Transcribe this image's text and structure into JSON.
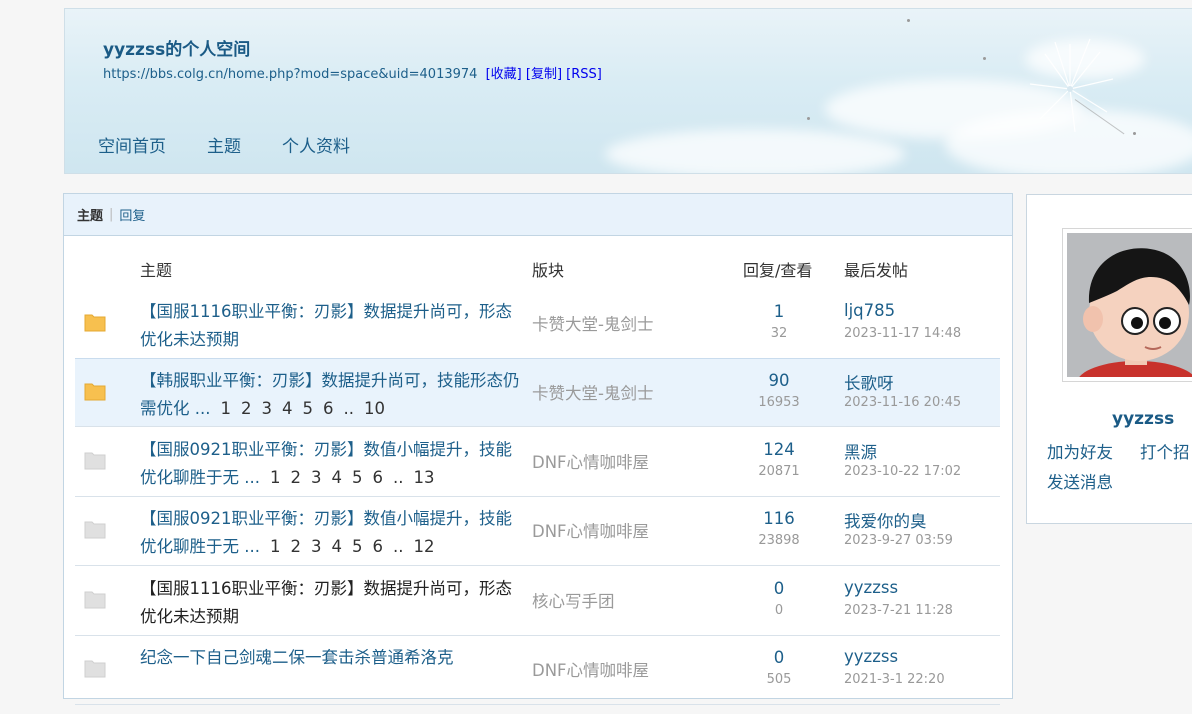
{
  "header": {
    "space_title": "yyzzss的个人空间",
    "space_url": "https://bbs.colg.cn/home.php?mod=space&uid=4013974",
    "url_actions": [
      "[收藏]",
      "[复制]",
      "[RSS]"
    ],
    "nav": [
      "空间首页",
      "主题",
      "个人资料"
    ]
  },
  "tabs": {
    "active": "主题",
    "separator": "|",
    "other": "回复"
  },
  "columns": {
    "subject": "主题",
    "forum": "版块",
    "stats": "回复/查看",
    "last_post": "最后发帖"
  },
  "threads": [
    {
      "subject": "【国服1116职业平衡：刃影】数据提升尚可，形态优化未达预期",
      "pages": [],
      "forum": "卡赞大堂-鬼剑士",
      "replies": "1",
      "views": "32",
      "last_user": "ljq785",
      "last_time": "2023-11-17 14:48"
    },
    {
      "subject": "【韩服职业平衡：刃影】数据提升尚可，技能形态仍需优化 ...",
      "pages": [
        "1",
        "2",
        "3",
        "4",
        "5",
        "6",
        "..",
        "10"
      ],
      "forum": "卡赞大堂-鬼剑士",
      "replies": "90",
      "views": "16953",
      "last_user": "长歌呀",
      "last_time": "2023-11-16 20:45"
    },
    {
      "subject": "【国服0921职业平衡：刃影】数值小幅提升，技能优化聊胜于无 ...",
      "pages": [
        "1",
        "2",
        "3",
        "4",
        "5",
        "6",
        "..",
        "13"
      ],
      "forum": "DNF心情咖啡屋",
      "replies": "124",
      "views": "20871",
      "last_user": "黑源",
      "last_time": "2023-10-22 17:02"
    },
    {
      "subject": "【国服0921职业平衡：刃影】数值小幅提升，技能优化聊胜于无 ...",
      "pages": [
        "1",
        "2",
        "3",
        "4",
        "5",
        "6",
        "..",
        "12"
      ],
      "forum": "DNF心情咖啡屋",
      "replies": "116",
      "views": "23898",
      "last_user": "我爱你的臭",
      "last_time": "2023-9-27 03:59"
    },
    {
      "subject": "【国服1116职业平衡：刃影】数据提升尚可，形态优化未达预期",
      "pages": [],
      "forum": "核心写手团",
      "replies": "0",
      "views": "0",
      "last_user": "yyzzss",
      "last_time": "2023-7-21 11:28"
    },
    {
      "subject": "纪念一下自己剑魂二保一套击杀普通希洛克",
      "pages": [],
      "forum": "DNF心情咖啡屋",
      "replies": "0",
      "views": "505",
      "last_user": "yyzzss",
      "last_time": "2021-3-1 22:20"
    }
  ],
  "profile": {
    "username": "yyzzss",
    "add_friend": "加为好友",
    "greet": "打个招",
    "send_message": "发送消息"
  },
  "colors": {
    "link": "#1d5f8a",
    "folder_new": "#f7c04f",
    "folder_old": "#e0e0e0",
    "highlight_row": "#e9f3fc"
  }
}
